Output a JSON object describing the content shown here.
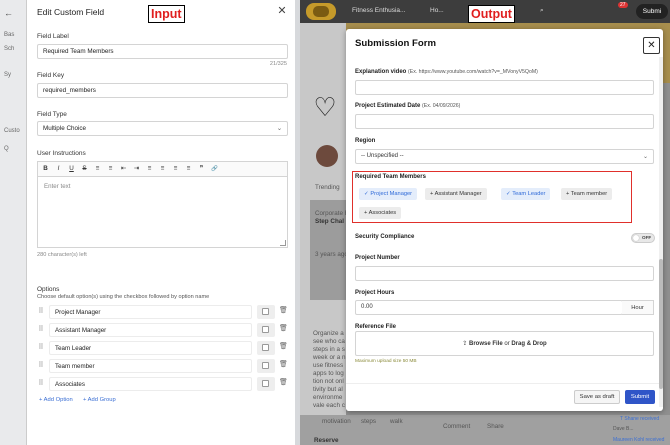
{
  "left_bg": {
    "back_arrow": "←",
    "items": [
      "Bas",
      "Sch",
      "Sy",
      "Custo",
      "Q"
    ]
  },
  "edit_field": {
    "title": "Edit Custom Field",
    "close": "✕",
    "field_label_label": "Field Label",
    "field_label_value": "Required Team Members",
    "char_count": "21/325",
    "field_key_label": "Field Key",
    "field_key_value": "required_members",
    "field_type_label": "Field Type",
    "field_type_value": "Multiple Choice",
    "instructions_label": "User Instructions",
    "toolbar": [
      "B",
      "I",
      "U",
      "S",
      "≡",
      "≡",
      "⇤",
      "⇥",
      "≡",
      "≡",
      "≡",
      "≡",
      "❞",
      "🔗"
    ],
    "editor_placeholder": "Enter text",
    "chars_left": "280 character(s) left",
    "options_label": "Options",
    "options_help": "Choose default option(s) using the checkbox followed by option name",
    "options": [
      "Project Manager",
      "Assistant Manager",
      "Team Leader",
      "Team member",
      "Associates"
    ],
    "add_option": "+ Add Option",
    "add_group": "+ Add Group"
  },
  "tags": {
    "input": "Input",
    "output": "Output"
  },
  "topbar": {
    "title": "Fitness Enthusia...",
    "ho": "Ho...",
    "badge": "27",
    "submit": "Submi"
  },
  "bg": {
    "trending": "Trending",
    "corporate": "Corporate F",
    "step": "Step Chal",
    "years": "3 years ago",
    "body": [
      "Organize a",
      "see who ca",
      "steps in a s",
      "week or a n",
      "use fitness",
      "apps to log",
      "tion not onl",
      "tivity but al",
      "environme",
      "vale each c"
    ],
    "tag1": "motivation",
    "tag2": "steps",
    "tag3": "walk",
    "comment": "Comment",
    "share": "Share",
    "reserve": "Reserve",
    "recv1": "T Shane received",
    "recv2": "Maureen Kohl received",
    "dave": "Dave B..."
  },
  "form": {
    "title": "Submission Form",
    "close": "✕",
    "explanation_label": "Explanation video",
    "explanation_sub": "(Ex. https://www.youtube.com/watch?v=_MVonyV5QoM)",
    "project_date_label": "Project Estimated Date",
    "project_date_sub": "(Ex. 04/09/2026)",
    "region_label": "Region",
    "region_value": "-- Unspecified --",
    "region_arrow": "⌄",
    "rtm_label": "Required Team Members",
    "chips": [
      {
        "label": "✓ Project Manager"
      },
      {
        "label": "+ Assistant Manager"
      },
      {
        "label": "✓ Team Leader"
      },
      {
        "label": "+ Team member"
      },
      {
        "label": "+ Associates"
      }
    ],
    "security_label": "Security Compliance",
    "security_state": "OFF",
    "project_number_label": "Project Number",
    "project_hours_label": "Project Hours",
    "project_hours_value": "0.00",
    "hours_unit": "Hour",
    "reference_label": "Reference File",
    "browse_file": "Browse File",
    "or_text": " or ",
    "drag_drop": "Drag & Drop",
    "upload_icon": "⇪",
    "upload_note": "Maximum upload size 50 MB",
    "save_draft": "Save as draft",
    "submit": "Submit"
  },
  "colors": {
    "accent": "#2f55c8",
    "highlight_border": "#e0302b",
    "selected_chip": "#e4edfb"
  }
}
